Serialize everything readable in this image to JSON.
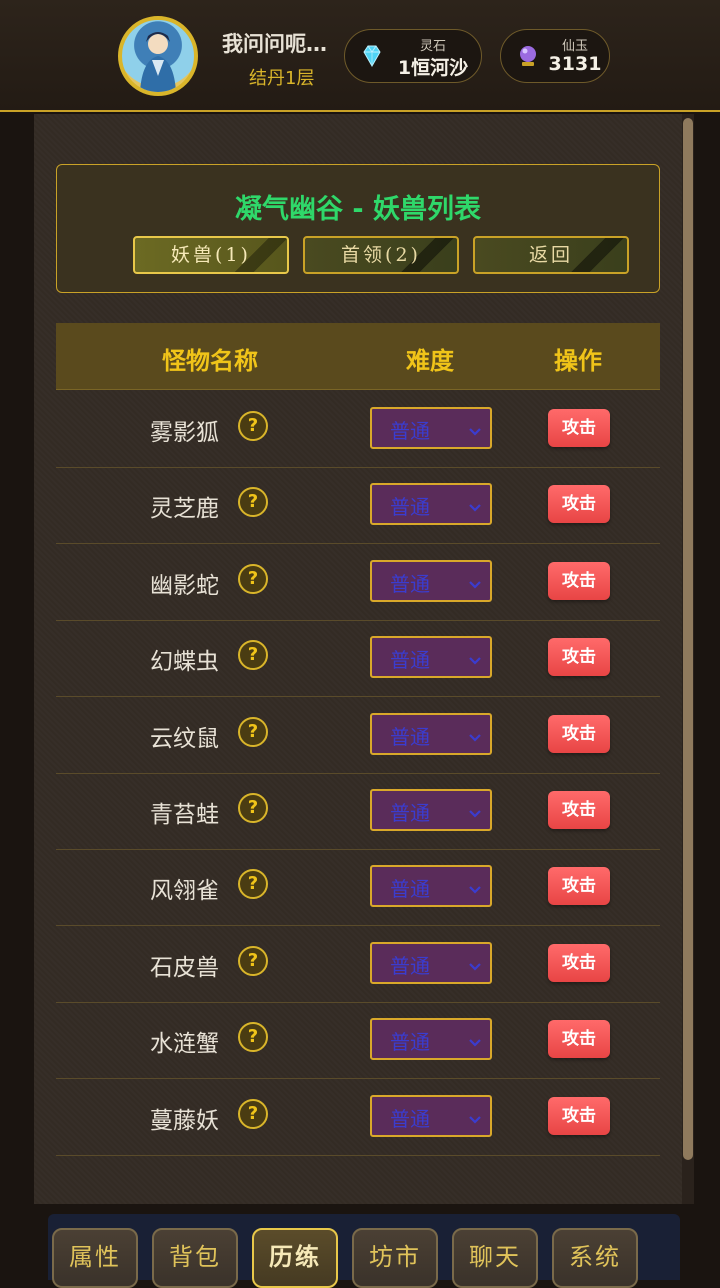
{
  "header": {
    "player_name": "我问问呃…",
    "realm": "结丹1层",
    "currencies": [
      {
        "label": "灵石",
        "value": "1恒河沙",
        "icon": "diamond-icon"
      },
      {
        "label": "仙玉",
        "value": "3131",
        "icon": "crystal-orb-icon"
      }
    ]
  },
  "zone": {
    "title": "凝气幽谷 - 妖兽列表",
    "tabs": [
      {
        "label": "妖兽(1)",
        "active": true
      },
      {
        "label": "首领(2)",
        "active": false
      },
      {
        "label": "返回",
        "active": false
      }
    ]
  },
  "table": {
    "headers": {
      "name": "怪物名称",
      "difficulty": "难度",
      "action": "操作"
    },
    "rows": [
      {
        "name": "雾影狐",
        "help": "?",
        "difficulty": "普通",
        "action": "攻击"
      },
      {
        "name": "灵芝鹿",
        "help": "?",
        "difficulty": "普通",
        "action": "攻击"
      },
      {
        "name": "幽影蛇",
        "help": "?",
        "difficulty": "普通",
        "action": "攻击"
      },
      {
        "name": "幻蝶虫",
        "help": "?",
        "difficulty": "普通",
        "action": "攻击"
      },
      {
        "name": "云纹鼠",
        "help": "?",
        "difficulty": "普通",
        "action": "攻击"
      },
      {
        "name": "青苔蛙",
        "help": "?",
        "difficulty": "普通",
        "action": "攻击"
      },
      {
        "name": "风翎雀",
        "help": "?",
        "difficulty": "普通",
        "action": "攻击"
      },
      {
        "name": "石皮兽",
        "help": "?",
        "difficulty": "普通",
        "action": "攻击"
      },
      {
        "name": "水涟蟹",
        "help": "?",
        "difficulty": "普通",
        "action": "攻击"
      },
      {
        "name": "蔓藤妖",
        "help": "?",
        "difficulty": "普通",
        "action": "攻击"
      }
    ]
  },
  "bottom_nav": [
    {
      "label": "属性",
      "active": false
    },
    {
      "label": "背包",
      "active": false
    },
    {
      "label": "历练",
      "active": true
    },
    {
      "label": "坊市",
      "active": false
    },
    {
      "label": "聊天",
      "active": false
    },
    {
      "label": "系统",
      "active": false
    }
  ],
  "colors": {
    "accent_gold": "#c9a227",
    "zone_title_green": "#2fd86a",
    "attack_red": "#e84545",
    "difficulty_purple": "#5a2c5a"
  }
}
